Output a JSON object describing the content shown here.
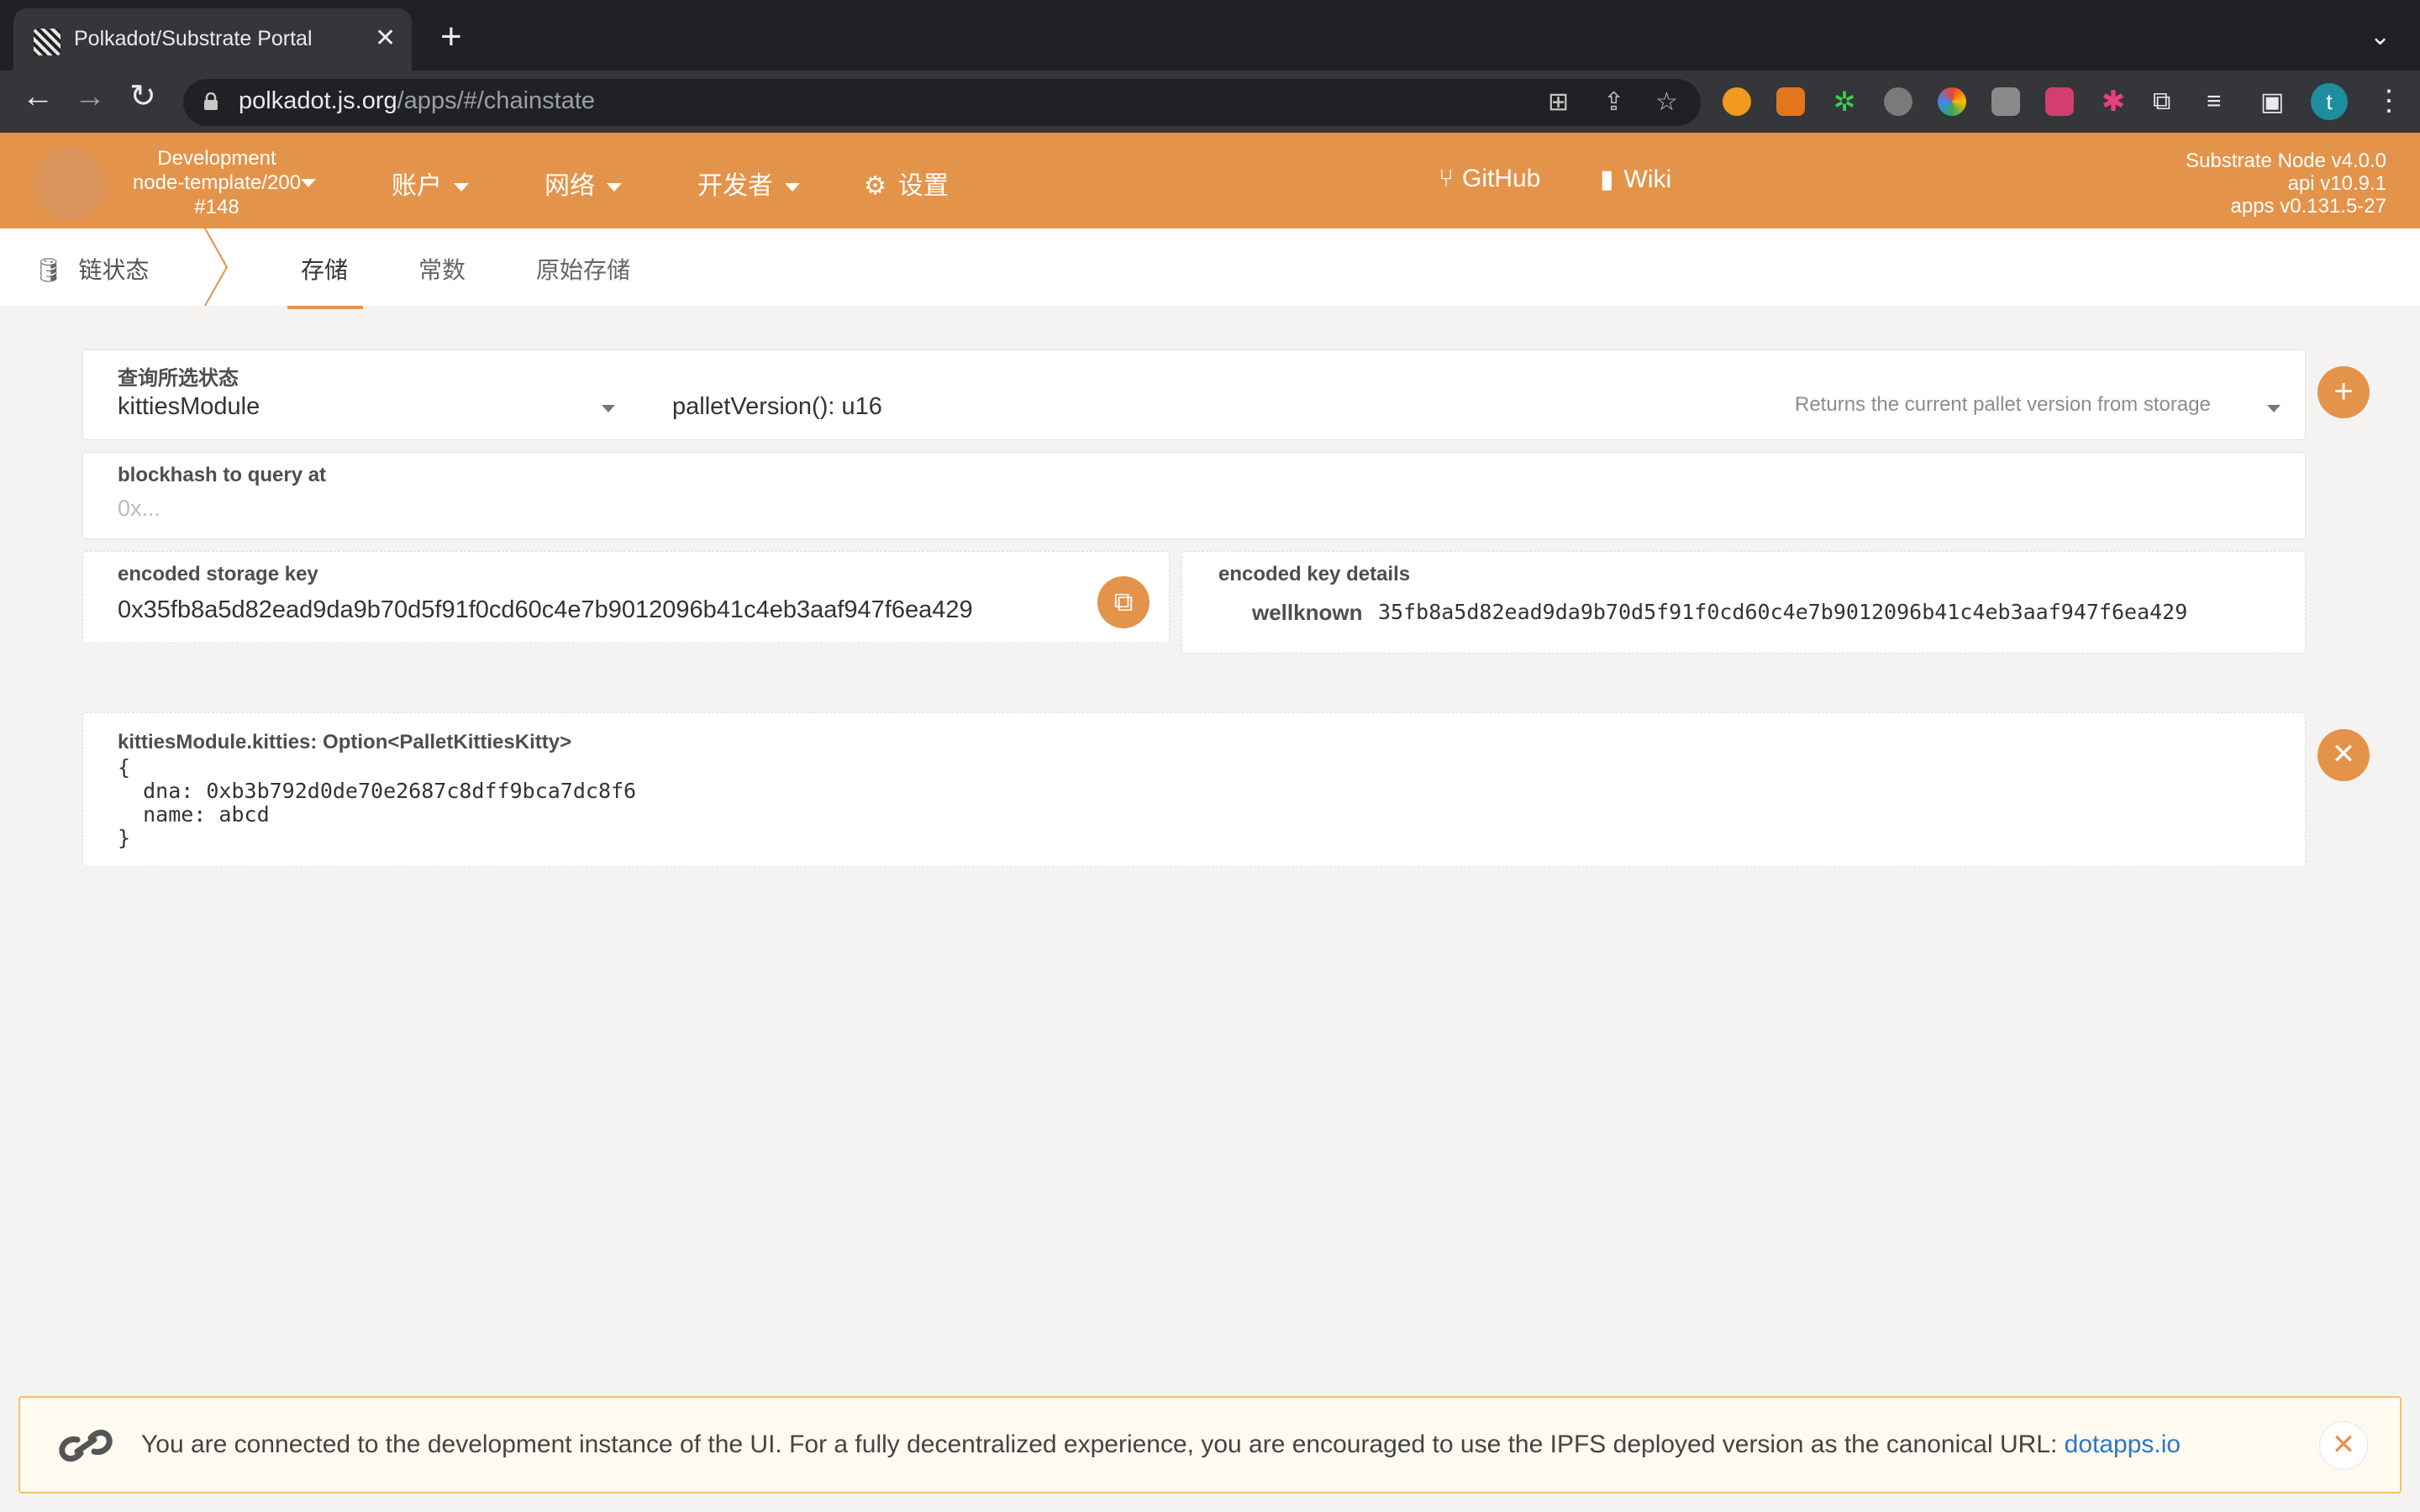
{
  "browser": {
    "tab_title": "Polkadot/Substrate Portal",
    "url_host": "polkadot.js.org",
    "url_path": "/apps/#/chainstate",
    "profile_initial": "t",
    "icons": [
      "back-icon",
      "forward-icon",
      "reload-icon",
      "lock-icon",
      "translate-icon",
      "share-icon",
      "star-icon",
      "puzzle-icon",
      "reading-list-icon",
      "side-panel-icon",
      "kebab-menu-icon"
    ]
  },
  "header": {
    "chain_name": "Development",
    "node_name": "node-template/200",
    "block_number": "#148",
    "menus": [
      {
        "label": "账户"
      },
      {
        "label": "网络"
      },
      {
        "label": "开发者"
      }
    ],
    "settings_label": "设置",
    "github_label": "GitHub",
    "wiki_label": "Wiki",
    "versions": [
      "Substrate Node v4.0.0",
      "api v10.9.1",
      "apps v0.131.5-27"
    ],
    "accent_color": "#e4934a"
  },
  "subnav": {
    "section_label": "链状态",
    "tabs": [
      {
        "label": "存储",
        "active": true
      },
      {
        "label": "常数",
        "active": false
      },
      {
        "label": "原始存储",
        "active": false
      }
    ]
  },
  "query": {
    "label": "查询所选状态",
    "module_value": "kittiesModule",
    "method_value": "palletVersion(): u16",
    "method_description": "Returns the current pallet version from storage"
  },
  "blockhash": {
    "label": "blockhash to query at",
    "placeholder": "0x..."
  },
  "encoded_key": {
    "label": "encoded storage key",
    "value": "0x35fb8a5d82ead9da9b70d5f91f0cd60c4e7b9012096b41c4eb3aaf947f6ea429"
  },
  "key_details": {
    "label": "encoded key details",
    "field_name": "wellknown",
    "field_value": "35fb8a5d82ead9da9b70d5f91f0cd60c4e7b9012096b41c4eb3aaf947f6ea429"
  },
  "result": {
    "title": "kittiesModule.kitties: Option<PalletKittiesKitty>",
    "lines": [
      "{",
      "  dna: 0xb3b792d0de70e2687c8dff9bca7dc8f6",
      "  name: abcd",
      "}"
    ]
  },
  "notice": {
    "text": "You are connected to the development instance of the UI. For a fully decentralized experience, you are encouraged to use the IPFS deployed version as the canonical URL: ",
    "link": "dotapps.io"
  }
}
